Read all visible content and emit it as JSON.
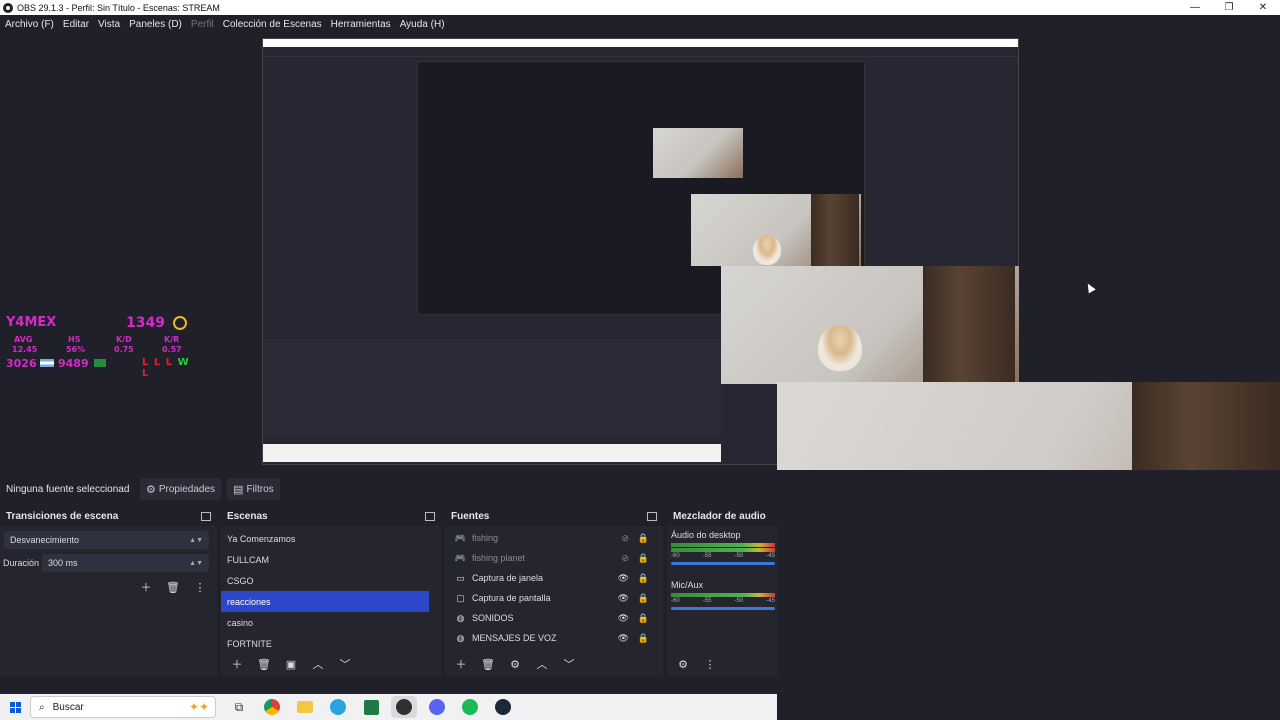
{
  "window": {
    "title": "OBS 29.1.3 - Perfil: Sin Título - Escenas: STREAM",
    "controls": {
      "minimize": "—",
      "restore": "❐",
      "close": "✕"
    }
  },
  "menu": [
    "Archivo (F)",
    "Editar",
    "Vista",
    "Paneles (D)",
    "Perfil",
    "Colección de Escenas",
    "Herramientas",
    "Ayuda (H)"
  ],
  "overlay": {
    "name": "Y4MEX",
    "rank": "1349",
    "labels": [
      "AVG",
      "HS",
      "K/D",
      "K/R"
    ],
    "values": [
      "12.45",
      "56%",
      "0.75",
      "0.57"
    ],
    "kills": "3026",
    "score": "9489",
    "results": [
      "L",
      "L",
      "L",
      "W",
      "L"
    ]
  },
  "context": {
    "no_selection": "Ninguna fuente seleccionad",
    "properties": "Propiedades",
    "filters": "Filtros"
  },
  "transitions": {
    "title": "Transiciones de escena",
    "type": "Desvanecimiento",
    "duration_label": "Duración",
    "duration_value": "300 ms"
  },
  "scenes": {
    "title": "Escenas",
    "items": [
      "Ya Comenzamos",
      "FULLCAM",
      "CSGO",
      "reacciones",
      "casino",
      "FORTNITE"
    ],
    "selected_index": 3
  },
  "sources": {
    "title": "Fuentes",
    "items": [
      {
        "name": "fishing",
        "icon": "gamepad-icon",
        "hidden": true
      },
      {
        "name": "fishing planet",
        "icon": "gamepad-icon",
        "hidden": true
      },
      {
        "name": "Captura de janela",
        "icon": "window-icon",
        "hidden": false
      },
      {
        "name": "Captura de pantalla",
        "icon": "monitor-icon",
        "hidden": false
      },
      {
        "name": "SONIDOS",
        "icon": "globe-icon",
        "hidden": false
      },
      {
        "name": "MENSAJES DE VOZ",
        "icon": "globe-icon",
        "hidden": false
      }
    ]
  },
  "mixer": {
    "title": "Mezclador de audio",
    "channels": [
      {
        "name": "Áudio do desktop",
        "ticks": [
          "-60",
          "-55",
          "-50",
          "-45"
        ]
      },
      {
        "name": "Mic/Aux",
        "ticks": [
          "-60",
          "-55",
          "-50",
          "-45"
        ]
      }
    ]
  },
  "taskbar": {
    "search_placeholder": "Buscar",
    "apps": [
      "task-view-icon",
      "chrome-icon",
      "files-icon",
      "telegram-icon",
      "excel-icon",
      "obs-icon",
      "discord-icon",
      "spotify-icon",
      "steam-icon"
    ]
  },
  "colors": {
    "accent": "#2b48c8",
    "overlay": "#d629c9",
    "win": "#2bd13a",
    "loss": "#e0202a"
  }
}
